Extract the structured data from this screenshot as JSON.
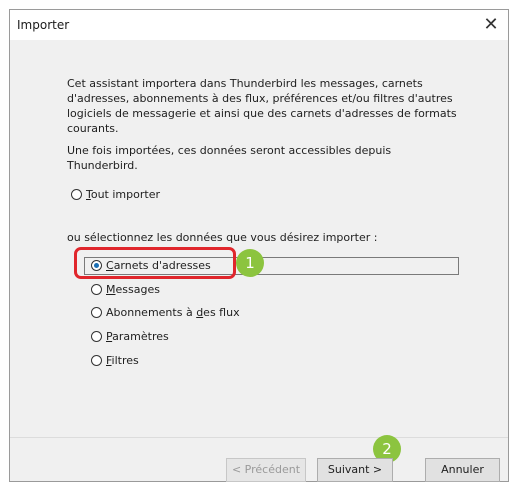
{
  "window": {
    "title": "Importer"
  },
  "intro": {
    "line1": "Cet assistant importera dans Thunderbird les messages, carnets",
    "line2": "d'adresses, abonnements à des flux, préférences et/ou filtres d'autres",
    "line3": "logiciels de messagerie et ainsi que des carnets d'adresses de formats",
    "line4": "courants.",
    "line5": "Une fois importées, ces données seront accessibles depuis Thunderbird."
  },
  "import_all": {
    "prefix": "",
    "key": "T",
    "rest": "out importer",
    "selected": false
  },
  "select_prompt": "ou sélectionnez les données que vous désirez importer :",
  "options": [
    {
      "prefix": "",
      "key": "C",
      "rest": "arnets d'adresses",
      "selected": true
    },
    {
      "prefix": "",
      "key": "M",
      "rest": "essages",
      "selected": false
    },
    {
      "prefix": "Abonnements à ",
      "key": "d",
      "rest": "es flux",
      "selected": false
    },
    {
      "prefix": "",
      "key": "P",
      "rest": "aramètres",
      "selected": false
    },
    {
      "prefix": "",
      "key": "F",
      "rest": "iltres",
      "selected": false
    }
  ],
  "badges": {
    "step1": "1",
    "step2": "2"
  },
  "buttons": {
    "previous": "< Précédent",
    "next": "Suivant >",
    "cancel": "Annuler"
  },
  "icons": {
    "close": "close-icon"
  },
  "colors": {
    "highlight": "#e0262c",
    "badge": "#8cc43f",
    "radio_dot": "#1a6fb5"
  }
}
